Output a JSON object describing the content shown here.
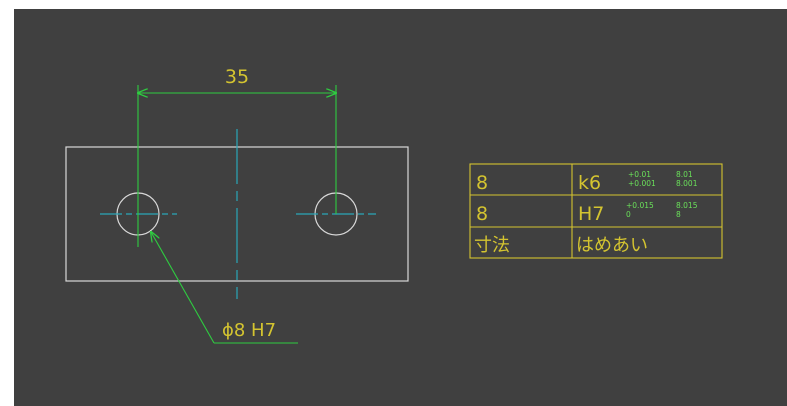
{
  "colors": {
    "background": "#404040",
    "outline": "#d8d8d8",
    "dimension": "#2ecc40",
    "centerline": "#2aa6b8",
    "annotation": "#d4c430",
    "tolerance": "#6ae05a"
  },
  "drawing": {
    "dimension_spacing": "35",
    "hole_callout": "ϕ8 H7"
  },
  "fit_table": {
    "rows": [
      {
        "size": "8",
        "fit": "k6",
        "tol_upper": "+0.01",
        "tol_lower": "+0.001",
        "alt_upper": "8.01",
        "alt_lower": "8.001"
      },
      {
        "size": "8",
        "fit": "H7",
        "tol_upper": "+0.015",
        "tol_lower": "0",
        "alt_upper": "8.015",
        "alt_lower": "8"
      }
    ],
    "header": {
      "size": "寸法",
      "fit": "はめあい"
    }
  }
}
